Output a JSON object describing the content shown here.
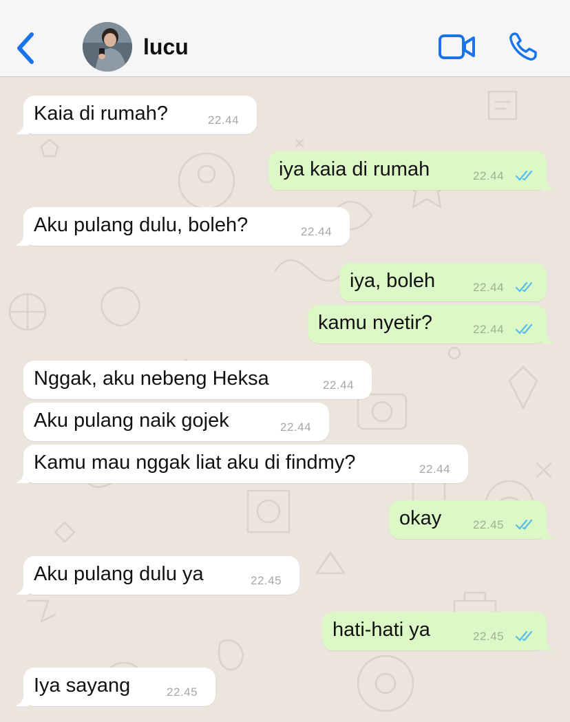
{
  "header": {
    "contact_name": "lucu",
    "back_icon": "chevron-left-icon",
    "video_icon": "video-camera-icon",
    "call_icon": "phone-icon",
    "accent_color": "#1a73e8"
  },
  "messages": [
    {
      "dir": "in",
      "text": "Kaia di rumah?",
      "time": "22.44"
    },
    {
      "dir": "out",
      "text": "iya kaia di rumah",
      "time": "22.44",
      "status": "read"
    },
    {
      "dir": "in",
      "text": "Aku pulang dulu, boleh?",
      "time": "22.44"
    },
    {
      "dir": "out",
      "text": "iya, boleh",
      "time": "22.44",
      "status": "read"
    },
    {
      "dir": "out",
      "text": "kamu nyetir?",
      "time": "22.44",
      "status": "read"
    },
    {
      "dir": "in",
      "text": "Nggak, aku nebeng Heksa",
      "time": "22.44"
    },
    {
      "dir": "in",
      "text": "Aku pulang naik gojek",
      "time": "22.44"
    },
    {
      "dir": "in",
      "text": "Kamu mau nggak liat aku di findmy?",
      "time": "22.44"
    },
    {
      "dir": "out",
      "text": "okay",
      "time": "22.45",
      "status": "read"
    },
    {
      "dir": "in",
      "text": "Aku pulang dulu ya",
      "time": "22.45"
    },
    {
      "dir": "out",
      "text": "hati-hati ya",
      "time": "22.45",
      "status": "read"
    },
    {
      "dir": "in",
      "text": "Iya sayang",
      "time": "22.45"
    }
  ],
  "colors": {
    "incoming_bubble": "#ffffff",
    "outgoing_bubble": "#dcf8c6",
    "read_ticks": "#53bdeb",
    "wallpaper": "#ece5dd"
  }
}
